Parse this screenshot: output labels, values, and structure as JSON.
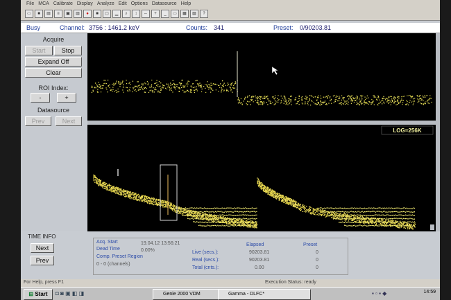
{
  "menu": [
    "File",
    "MCA",
    "Calibrate",
    "Display",
    "Analyze",
    "Edit",
    "Options",
    "Datasource",
    "Help"
  ],
  "status": {
    "state": "Busy",
    "channel_label": "Channel:",
    "channel": "3756 : 1461.2 keV",
    "counts_label": "Counts:",
    "counts": "341",
    "preset_label": "Preset:",
    "preset": "0/90203.81"
  },
  "acquire": {
    "title": "Acquire",
    "start": "Start",
    "stop": "Stop",
    "expand": "Expand Off",
    "clear": "Clear"
  },
  "roi": {
    "title": "ROI Index:",
    "minus": "-",
    "plus": "+"
  },
  "datasource": {
    "title": "Datasource",
    "prev": "Prev",
    "next": "Next"
  },
  "expanded": {
    "log_badge": "LOG=256K"
  },
  "time_info": {
    "title": "TIME INFO",
    "next": "Next",
    "prev": "Prev",
    "acq_start_label": "Acq. Start",
    "acq_start": "19.04.12  13:56:21",
    "dead_time_label": "Dead Time",
    "dead_time": "0.00%",
    "comp_label": "Comp. Preset Region",
    "comp_value": "0 - 0 (channels)",
    "elapsed_header": "Elapsed",
    "preset_header": "Preset",
    "live_label": "Live (secs.):",
    "live_elapsed": "90203.81",
    "live_preset": "0",
    "real_label": "Real (secs.):",
    "real_elapsed": "90203.81",
    "real_preset": "0",
    "total_label": "Total (cnts.):",
    "total_elapsed": "0.00",
    "total_preset": "0"
  },
  "helpbar": {
    "left": "For Help, press F1",
    "right": "Execution Status: ready"
  },
  "taskbar": {
    "start": "Start",
    "task1": "Genie 2000 VDM",
    "task2": "Gamma - DLFC*",
    "clock": "14:59"
  }
}
